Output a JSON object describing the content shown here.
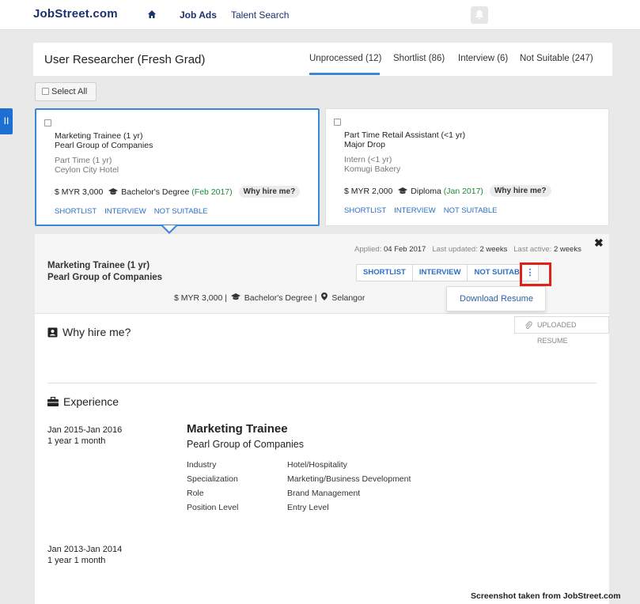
{
  "nav": {
    "logo": "JobStreet.com",
    "links": [
      "Job Ads",
      "Talent Search"
    ]
  },
  "header": {
    "job_title": "User Researcher (Fresh Grad)",
    "tabs": [
      "Unprocessed (12)",
      "Shortlist (86)",
      "Interview (6)",
      "Not Suitable (247)"
    ],
    "active_tab": "Unprocessed (12)"
  },
  "select_all": "Select All",
  "cards": [
    {
      "role1": "Marketing Trainee (1 yr)",
      "company1": "Pearl Group of Companies",
      "role2": "Part Time (1 yr)",
      "company2": "Ceylon City Hotel",
      "salary": "$ MYR 3,000",
      "education": "Bachelor's Degree",
      "grad": "(Feb 2017)",
      "why": "Why hire me?",
      "actions": [
        "SHORTLIST",
        "INTERVIEW",
        "NOT SUITABLE"
      ]
    },
    {
      "role1": "Part Time Retail Assistant (<1 yr)",
      "company1": "Major Drop",
      "role2": "Intern (<1 yr)",
      "company2": "Komugi Bakery",
      "salary": "$ MYR 2,000",
      "education": "Diploma",
      "grad": "(Jan 2017)",
      "why": "Why hire me?",
      "actions": [
        "SHORTLIST",
        "INTERVIEW",
        "NOT SUITABLE"
      ]
    }
  ],
  "detail": {
    "applied_label": "Applied:",
    "applied": "04 Feb 2017",
    "updated_label": "Last updated:",
    "updated": "2 weeks",
    "active_label": "Last active:",
    "active": "2 weeks",
    "title": "Marketing Trainee (1 yr)",
    "company": "Pearl Group of Companies",
    "buttons": [
      "SHORTLIST",
      "INTERVIEW",
      "NOT SUITABLE"
    ],
    "more": "⋮",
    "dropdown_item": "Download Resume",
    "summary_salary": "$ MYR 3,000 |",
    "summary_edu": "Bachelor's Degree |",
    "summary_loc": "Selangor",
    "uploaded": "UPLOADED RESUME",
    "why_title": "Why hire me?",
    "exp_title": "Experience",
    "experiences": [
      {
        "dates": "Jan 2015-Jan 2016",
        "duration": "1 year 1 month",
        "role": "Marketing Trainee",
        "company": "Pearl Group of Companies",
        "fields": [
          {
            "k": "Industry",
            "v": "Hotel/Hospitality"
          },
          {
            "k": "Specialization",
            "v": "Marketing/Business Development"
          },
          {
            "k": "Role",
            "v": "Brand Management"
          },
          {
            "k": "Position Level",
            "v": "Entry Level"
          }
        ]
      },
      {
        "dates": "Jan 2013-Jan 2014",
        "duration": "1 year 1 month"
      }
    ]
  },
  "footer_note": "Screenshot taken from JobStreet.com",
  "colors": {
    "accent": "#3b86d5",
    "link": "#2b6ec6",
    "highlight": "#e0211a",
    "green": "#1a8a36",
    "brand": "#1c2f6e"
  }
}
